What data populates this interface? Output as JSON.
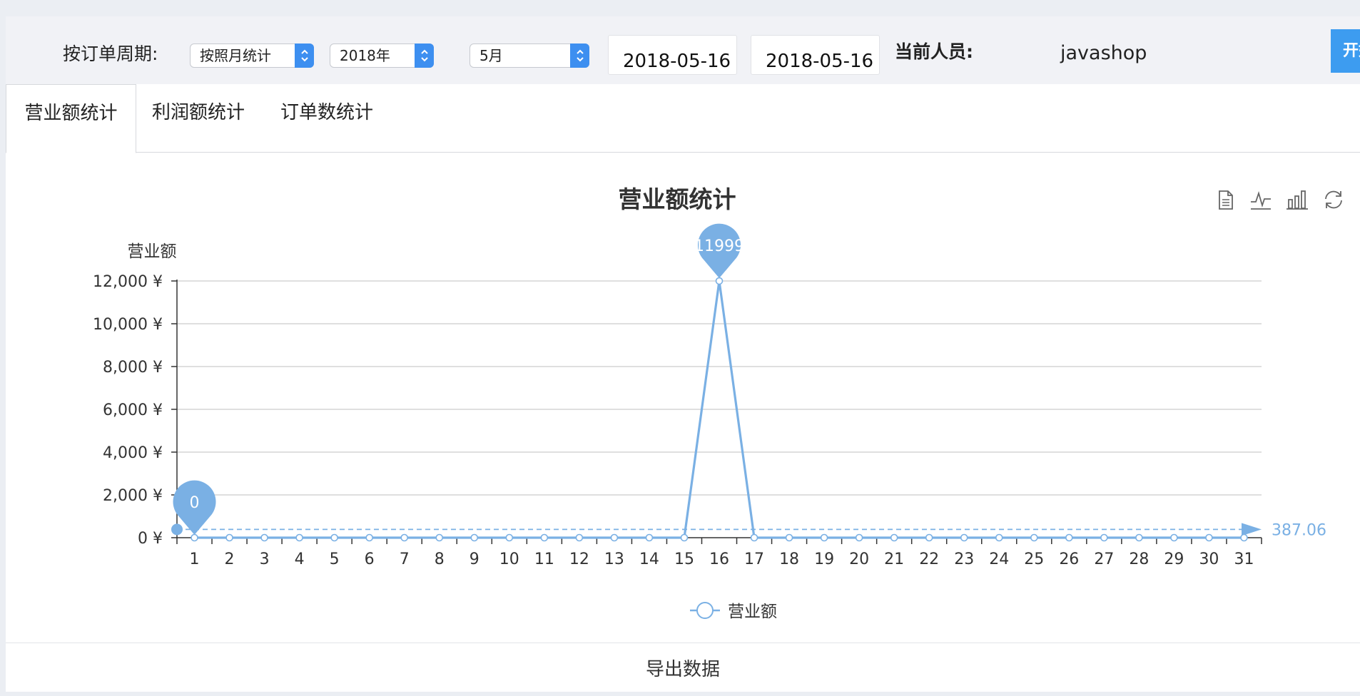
{
  "filter": {
    "label": "按订单周期:",
    "period_select": "按照月统计",
    "year_select": "2018年",
    "month_select": "5月",
    "start_date": "2018-05-16",
    "end_date": "2018-05-16",
    "person_label": "当前人员:",
    "person_name": "javashop",
    "start_button": "开始"
  },
  "tabs": [
    {
      "label": "营业额统计",
      "active": true
    },
    {
      "label": "利润额统计",
      "active": false
    },
    {
      "label": "订单数统计",
      "active": false
    }
  ],
  "toolbox": [
    "data-view-icon",
    "line-chart-icon",
    "bar-chart-icon",
    "restore-icon"
  ],
  "export_label": "导出数据",
  "colors": {
    "series": "#7ab0e4",
    "axis": "#333333",
    "grid": "#cccccc"
  },
  "chart_data": {
    "type": "line",
    "title": "营业额统计",
    "ylabel": "营业额",
    "xlabel": "",
    "y_unit": "¥",
    "ylim": [
      0,
      12000
    ],
    "y_ticks": [
      "0",
      "2,000",
      "4,000",
      "6,000",
      "8,000",
      "10,000",
      "12,000"
    ],
    "x": [
      "1",
      "2",
      "3",
      "4",
      "5",
      "6",
      "7",
      "8",
      "9",
      "10",
      "11",
      "12",
      "13",
      "14",
      "15",
      "16",
      "17",
      "18",
      "19",
      "20",
      "21",
      "22",
      "23",
      "24",
      "25",
      "26",
      "27",
      "28",
      "29",
      "30",
      "31"
    ],
    "series": [
      {
        "name": "营业额",
        "values": [
          0,
          0,
          0,
          0,
          0,
          0,
          0,
          0,
          0,
          0,
          0,
          0,
          0,
          0,
          0,
          11999,
          0,
          0,
          0,
          0,
          0,
          0,
          0,
          0,
          0,
          0,
          0,
          0,
          0,
          0,
          0
        ]
      }
    ],
    "mark_points": [
      {
        "label": "11999",
        "x": "16",
        "value": 11999
      },
      {
        "label": "0",
        "x": "1",
        "value": 0
      }
    ],
    "mark_line": {
      "label": "387.06",
      "value": 387.06
    },
    "grid": true,
    "legend": "bottom-center"
  }
}
